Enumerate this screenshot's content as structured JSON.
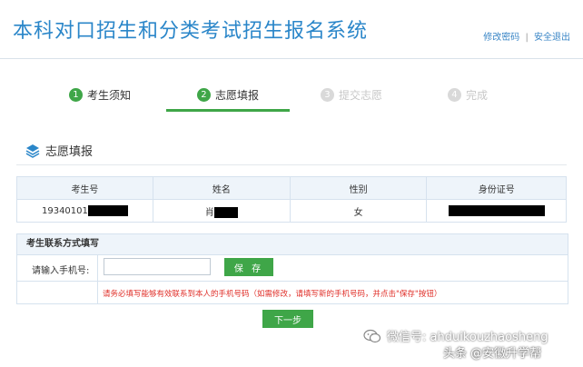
{
  "header": {
    "title": "本科对口招生和分类考试招生报名系统",
    "change_password": "修改密码",
    "separator": "|",
    "logout": "安全退出"
  },
  "steps": [
    {
      "num": "1",
      "label": "考生须知",
      "state": "done"
    },
    {
      "num": "2",
      "label": "志愿填报",
      "state": "active"
    },
    {
      "num": "3",
      "label": "提交志愿",
      "state": "todo"
    },
    {
      "num": "4",
      "label": "完成",
      "state": "todo"
    }
  ],
  "section": {
    "title": "志愿填报",
    "icon": "layers-icon"
  },
  "info_table": {
    "headers": [
      "考生号",
      "姓名",
      "性别",
      "身份证号"
    ],
    "row": {
      "exam_no": "19340101",
      "name": "肖",
      "gender": "女"
    }
  },
  "contact": {
    "heading": "考生联系方式填写",
    "phone_label": "请输入手机号:",
    "phone_value": "",
    "save_label": "保 存",
    "note": "请务必填写能够有效联系到本人的手机号码（如需修改，请填写新的手机号码，并点击\"保存\"按钮）"
  },
  "next_label": "下一步",
  "watermark": {
    "wechat": "微信号: ahduikouzhaosheng",
    "source": "头条 @安徽升学帮"
  },
  "colors": {
    "accent_green": "#3fa648",
    "title_blue": "#2a86c9",
    "note_red": "#e0302a"
  }
}
